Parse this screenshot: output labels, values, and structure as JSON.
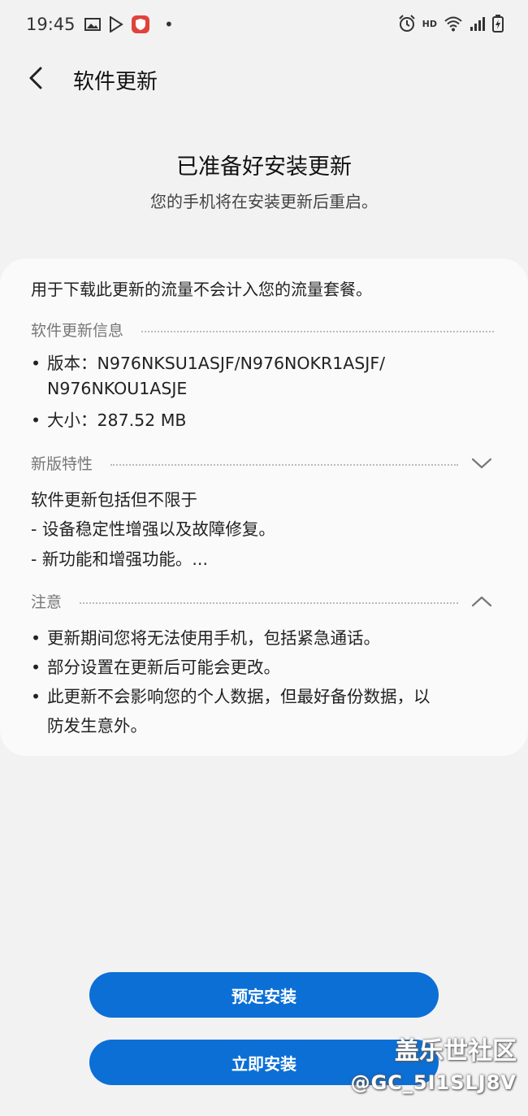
{
  "status": {
    "time": "19:45",
    "hd": "HD"
  },
  "header": {
    "title": "软件更新"
  },
  "hero": {
    "title": "已准备好安装更新",
    "subtitle": "您的手机将在安装更新后重启。"
  },
  "card": {
    "notice": "用于下载此更新的流量不会计入您的流量套餐。",
    "info": {
      "heading": "软件更新信息",
      "version_line1": "版本：N976NKSU1ASJF/N976NOKR1ASJF/",
      "version_line2": "N976NKOU1ASJE",
      "size": "大小：287.52 MB"
    },
    "features": {
      "heading": "新版特性",
      "intro": "软件更新包括但不限于",
      "item1": "- 设备稳定性增强以及故障修复。",
      "item2": "- 新功能和增强功能。..."
    },
    "notes": {
      "heading": "注意",
      "item1": "更新期间您将无法使用手机，包括紧急通话。",
      "item2": "部分设置在更新后可能会更改。",
      "item3_line1": "此更新不会影响您的个人数据，但最好备份数据，以",
      "item3_line2": "防发生意外。"
    }
  },
  "buttons": {
    "schedule": "预定安装",
    "install_now": "立即安装"
  },
  "watermark": {
    "line1": "盖乐世社区",
    "line2": "@GC_5I1SLJ8V"
  },
  "colors": {
    "accent": "#0b6fd6",
    "background": "#f2f2f2",
    "card": "#fafafa"
  }
}
